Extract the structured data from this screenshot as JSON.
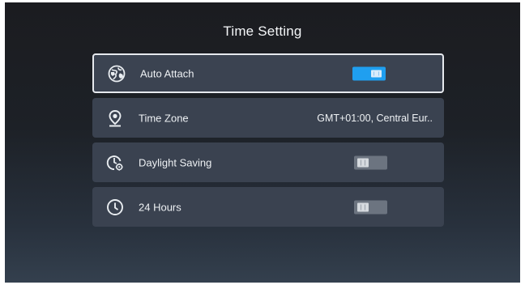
{
  "page": {
    "title": "Time Setting"
  },
  "items": [
    {
      "label": "Auto Attach",
      "control": "toggle",
      "state": "on",
      "icon": "globe-icon",
      "selected": true
    },
    {
      "label": "Time Zone",
      "control": "value",
      "value": "GMT+01:00, Central Eur..",
      "icon": "location-pin-icon",
      "selected": false
    },
    {
      "label": "Daylight Saving",
      "control": "toggle",
      "state": "off",
      "icon": "clock-gear-icon",
      "selected": false
    },
    {
      "label": "24 Hours",
      "control": "toggle",
      "state": "off",
      "icon": "clock-icon",
      "selected": false
    }
  ],
  "colors": {
    "toggle_on": "#1f9ff0",
    "toggle_off": "#6c7480",
    "row_background": "#3a4250",
    "selection_border": "#e6e9ee"
  }
}
